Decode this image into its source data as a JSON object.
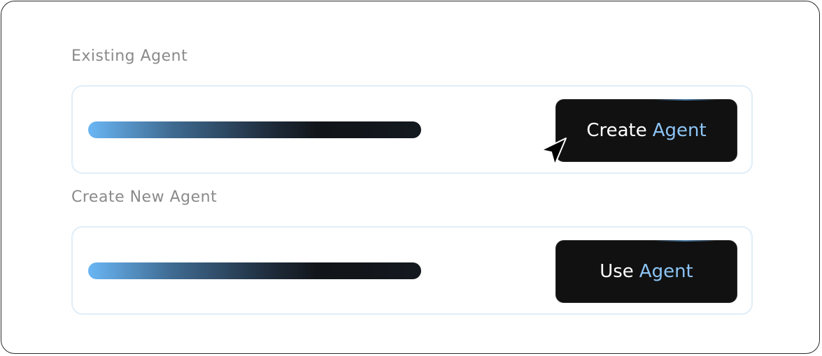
{
  "sections": [
    {
      "label": "Existing Agent",
      "button": {
        "label_main": "Create",
        "label_accent": "Agent"
      }
    },
    {
      "label": "Create New Agent",
      "button": {
        "label_main": "Use",
        "label_accent": "Agent"
      }
    }
  ],
  "colors": {
    "accent": "#8cc4f5",
    "button_bg": "#111111",
    "card_border": "#e0eef9",
    "label_text": "#8a8a8a",
    "bar_gradient": [
      "#6ab6f5",
      "#111418"
    ]
  },
  "icons": {
    "cursor": "mouse-pointer-icon"
  }
}
